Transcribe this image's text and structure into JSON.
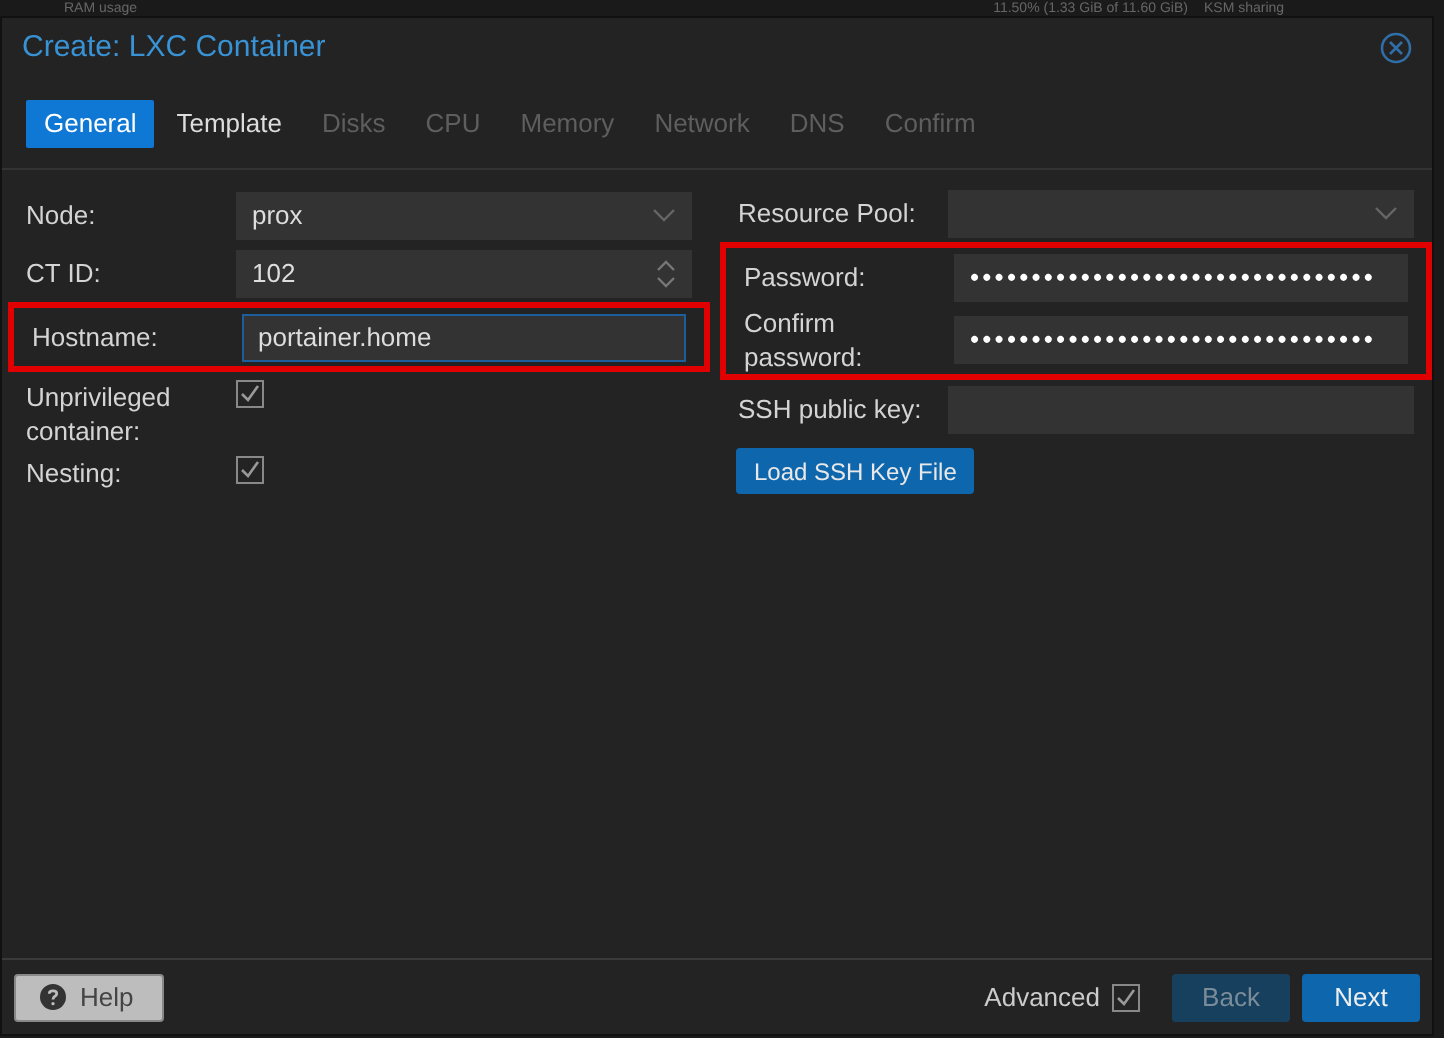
{
  "background": {
    "text": "RAM usage",
    "reading": "11.50% (1.33 GiB of 11.60 GiB)",
    "extra": "KSM sharing"
  },
  "window": {
    "title": "Create: LXC Container"
  },
  "tabs": [
    {
      "label": "General",
      "selected": true,
      "disabled": false
    },
    {
      "label": "Template",
      "selected": false,
      "disabled": false
    },
    {
      "label": "Disks",
      "selected": false,
      "disabled": true
    },
    {
      "label": "CPU",
      "selected": false,
      "disabled": true
    },
    {
      "label": "Memory",
      "selected": false,
      "disabled": true
    },
    {
      "label": "Network",
      "selected": false,
      "disabled": true
    },
    {
      "label": "DNS",
      "selected": false,
      "disabled": true
    },
    {
      "label": "Confirm",
      "selected": false,
      "disabled": true
    }
  ],
  "left_fields": [
    {
      "kind": "select",
      "label": "Node:",
      "value": "prox",
      "highlighted": false
    },
    {
      "kind": "spinner",
      "label": "CT ID:",
      "value": "102",
      "highlighted": false
    },
    {
      "kind": "text",
      "label": "Hostname:",
      "value": "portainer.home",
      "highlighted": true,
      "focused": true
    },
    {
      "kind": "checkbox",
      "label": "Unprivileged container:",
      "checked": true,
      "highlighted": false
    },
    {
      "kind": "checkbox",
      "label": "Nesting:",
      "checked": true,
      "highlighted": false
    }
  ],
  "right_fields": [
    {
      "kind": "select",
      "label": "Resource Pool:",
      "highlighted": false
    },
    {
      "kind": "password",
      "label": "Password:",
      "value": "•••••••••••••••••••••••••••••••••",
      "highlighted": true
    },
    {
      "kind": "password",
      "label": "Confirm password:",
      "value": "•••••••••••••••••••••••••••••••••",
      "highlighted": true
    },
    {
      "kind": "text",
      "label": "SSH public key:",
      "highlighted": false
    }
  ],
  "load_key_button": "Load SSH Key File",
  "footer": {
    "help": "Help",
    "advanced": {
      "label": "Advanced",
      "checked": true
    },
    "buttons": [
      {
        "label": "Back",
        "disabled": true
      },
      {
        "label": "Next",
        "disabled": false
      }
    ]
  }
}
